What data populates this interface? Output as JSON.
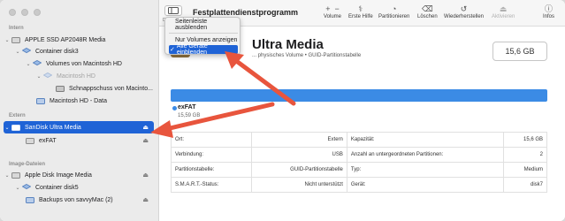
{
  "window": {
    "title": "Festplattendienstprogramm"
  },
  "toolbar": {
    "view_caption": "D",
    "buttons": [
      {
        "label": "Volume",
        "icon": "plus-minus-icon",
        "enabled": true
      },
      {
        "label": "Erste Hilfe",
        "icon": "stethoscope-icon",
        "enabled": true
      },
      {
        "label": "Partitionieren",
        "icon": "pie-chart-icon",
        "enabled": true
      },
      {
        "label": "Löschen",
        "icon": "erase-icon",
        "enabled": true
      },
      {
        "label": "Wiederherstellen",
        "icon": "restore-icon",
        "enabled": true
      },
      {
        "label": "Aktivieren",
        "icon": "eject-icon",
        "enabled": false
      },
      {
        "label": "Infos",
        "icon": "info-icon",
        "enabled": true
      }
    ]
  },
  "view_menu": {
    "items": [
      {
        "label": "Seitenleiste ausblenden",
        "checked": false
      },
      {
        "label": "Nur Volumes anzeigen",
        "checked": false
      },
      {
        "label": "Alle Geräte einblenden",
        "checked": true
      }
    ]
  },
  "sidebar": {
    "sections": [
      {
        "label": "Intern"
      },
      {
        "label": "Extern"
      },
      {
        "label": "Image-Dateien"
      }
    ],
    "items": [
      {
        "label": "APPLE SSD AP2048R Media"
      },
      {
        "label": "Container disk3"
      },
      {
        "label": "Volumes von Macintosh HD"
      },
      {
        "label": "Macintosh HD"
      },
      {
        "label": "Schnappschuss von Macinto..."
      },
      {
        "label": "Macintosh HD - Data"
      },
      {
        "label": "SanDisk Ultra Media"
      },
      {
        "label": "exFAT"
      },
      {
        "label": "Apple Disk Image Media"
      },
      {
        "label": "Container disk5"
      },
      {
        "label": "Backups von savvyMac (2)"
      }
    ]
  },
  "disk": {
    "title": "Ultra Media",
    "subtitle": "... physisches Volume • GUID-Partitionstabelle",
    "size": "15,6 GB"
  },
  "usage": {
    "accent": "#3b8be5",
    "partition_name": "exFAT",
    "partition_size": "15,59 GB",
    "fill_fraction": 1.0
  },
  "info_table": [
    {
      "left_label": "Ort:",
      "left_value": "Extern",
      "right_label": "Kapazität:",
      "right_value": "15,6 GB"
    },
    {
      "left_label": "Verbindung:",
      "left_value": "USB",
      "right_label": "Anzahl an untergeordneten Partitionen:",
      "right_value": "2"
    },
    {
      "left_label": "Partitionstabelle:",
      "left_value": "GUID-Partitionstabelle",
      "right_label": "Typ:",
      "right_value": "Medium"
    },
    {
      "left_label": "S.M.A.R.T.-Status:",
      "left_value": "Nicht unterstützt",
      "right_label": "Gerät:",
      "right_value": "disk7"
    }
  ],
  "colors": {
    "selection": "#1f63d6",
    "annotation_arrow": "#e8553d"
  }
}
